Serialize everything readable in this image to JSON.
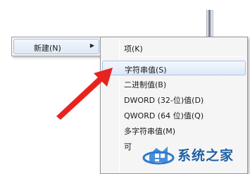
{
  "parent_menu": {
    "item_label": "新建(N)",
    "arrow_icon": "submenu-arrow-icon"
  },
  "submenu": {
    "items": [
      {
        "label": "项(K)"
      },
      {
        "label": "字符串值(S)"
      },
      {
        "label": "二进制值(B)"
      },
      {
        "label": "DWORD (32-位)值(D)"
      },
      {
        "label": "QWORD (64 位)值(Q)"
      },
      {
        "label": "多字符串值(M)"
      },
      {
        "label": "可"
      }
    ],
    "highlighted_index": 1
  },
  "annotation": {
    "arrow_color": "#e8231f"
  },
  "watermark": {
    "text": "系统之家",
    "color": "#1e5fa3"
  }
}
